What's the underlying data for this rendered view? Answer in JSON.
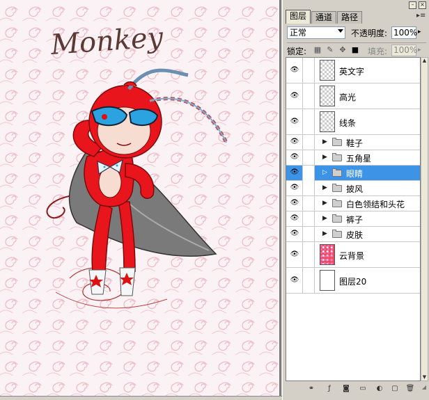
{
  "canvas": {
    "artwork_title": "Monkey",
    "colors": {
      "background": "#f8eef0",
      "swirl": "#f0a8b8",
      "suit": "#e8161c",
      "goggles": "#2ba3e0"
    }
  },
  "panel": {
    "tabs": [
      {
        "label": "图层",
        "active": true
      },
      {
        "label": "通道",
        "active": false
      },
      {
        "label": "路径",
        "active": false
      }
    ],
    "blend_mode": "正常",
    "opacity_label": "不透明度:",
    "opacity_value": "100%",
    "lock_label": "锁定:",
    "fill_label": "填充:",
    "fill_value": "100%",
    "layers": [
      {
        "name": "英文字",
        "kind": "layer",
        "thumb": "transparent",
        "visible": true,
        "selected": false
      },
      {
        "name": "高光",
        "kind": "layer",
        "thumb": "transparent",
        "visible": true,
        "selected": false
      },
      {
        "name": "线条",
        "kind": "layer",
        "thumb": "transparent",
        "visible": true,
        "selected": false
      },
      {
        "name": "鞋子",
        "kind": "group",
        "visible": true,
        "selected": false
      },
      {
        "name": "五角星",
        "kind": "group",
        "visible": true,
        "selected": false
      },
      {
        "name": "眼睛",
        "kind": "group",
        "visible": true,
        "selected": true
      },
      {
        "name": "披风",
        "kind": "group",
        "visible": true,
        "selected": false
      },
      {
        "name": "白色领结和头花",
        "kind": "group",
        "visible": true,
        "selected": false
      },
      {
        "name": "裤子",
        "kind": "group",
        "visible": true,
        "selected": false
      },
      {
        "name": "皮肤",
        "kind": "group",
        "visible": true,
        "selected": false
      },
      {
        "name": "云背景",
        "kind": "layer",
        "thumb": "cloud",
        "visible": true,
        "selected": false
      },
      {
        "name": "图层20",
        "kind": "layer",
        "thumb": "white",
        "visible": true,
        "selected": false
      }
    ],
    "selection_color": "#3d93e6",
    "bottom_icons": [
      "link-layers-icon",
      "layer-style-icon",
      "layer-mask-icon",
      "new-group-icon",
      "adjustment-layer-icon",
      "new-layer-icon",
      "trash-icon"
    ]
  }
}
